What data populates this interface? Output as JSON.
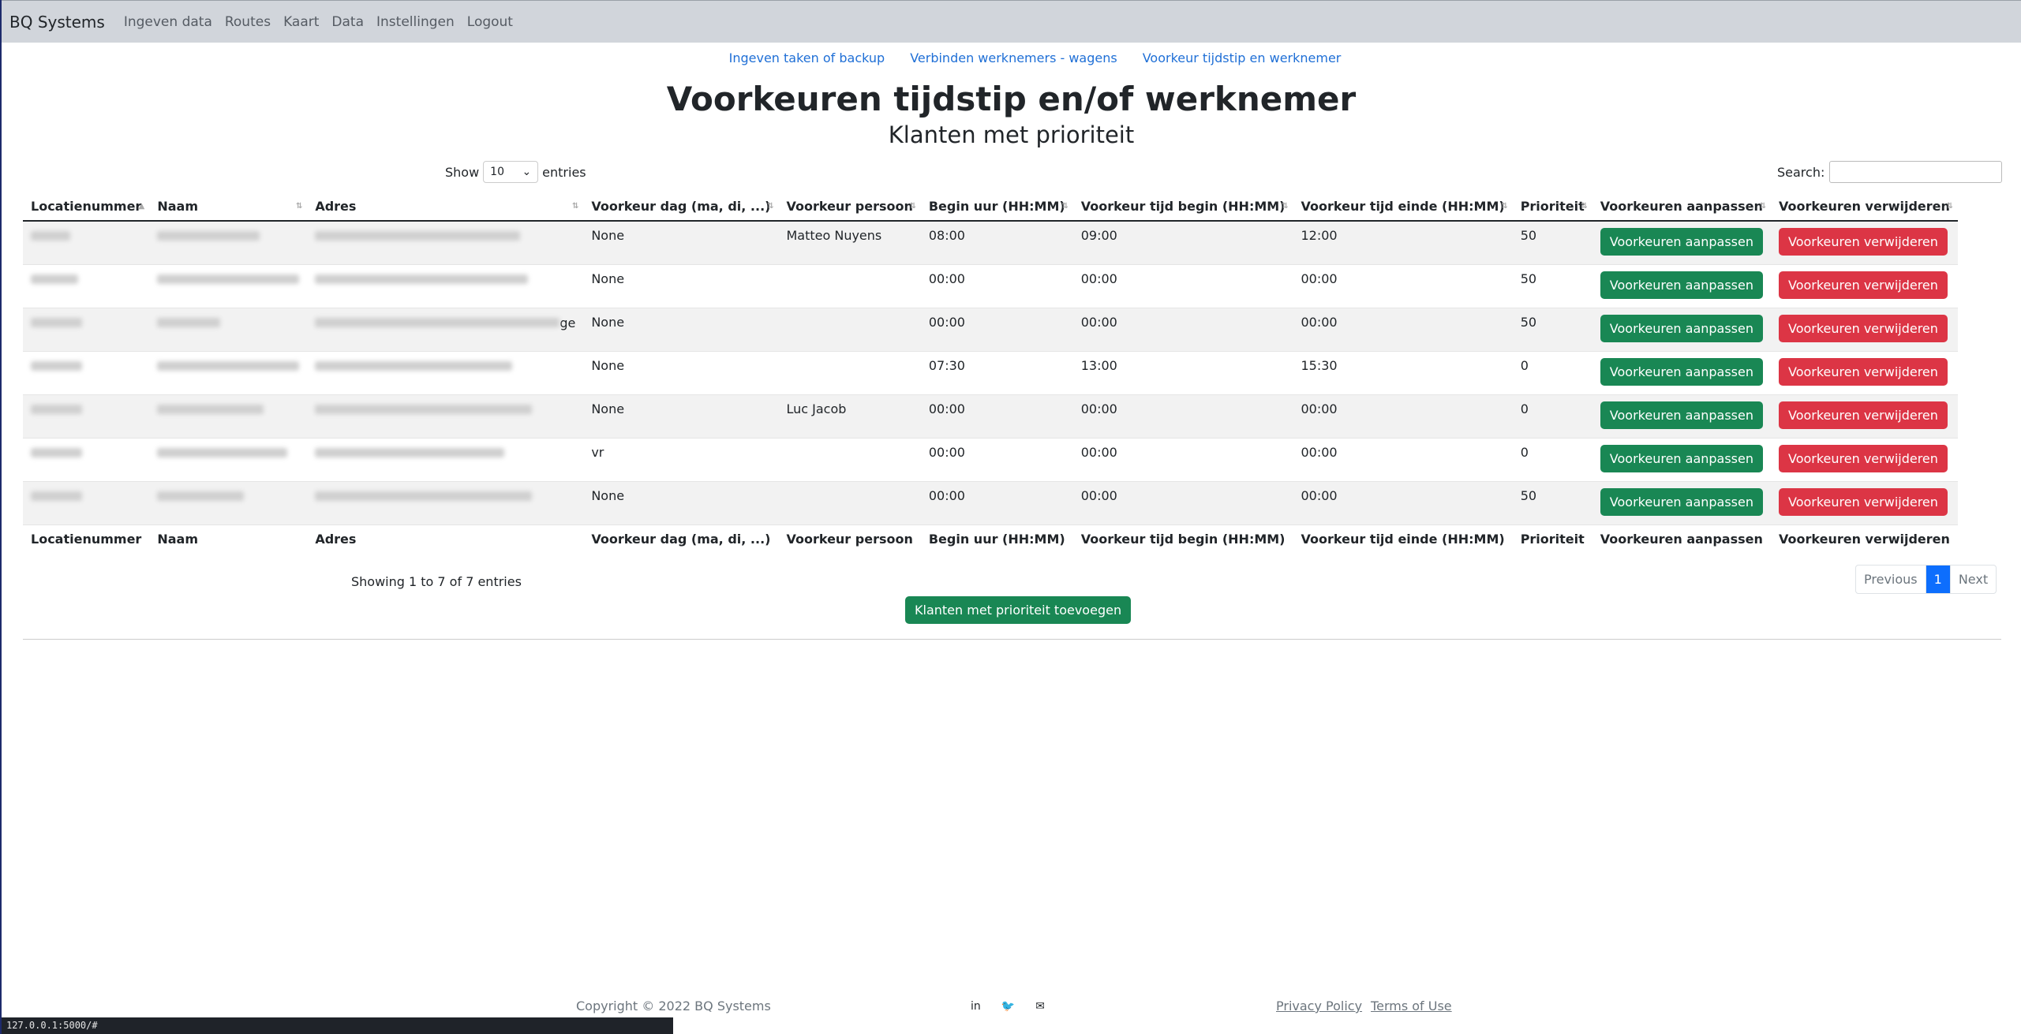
{
  "navbar": {
    "brand": "BQ Systems",
    "items": [
      "Ingeven data",
      "Routes",
      "Kaart",
      "Data",
      "Instellingen",
      "Logout"
    ]
  },
  "subnav": [
    "Ingeven taken of backup",
    "Verbinden werknemers - wagens",
    "Voorkeur tijdstip en werknemer"
  ],
  "page": {
    "title": "Voorkeuren tijdstip en/of werknemer",
    "subtitle": "Klanten met prioriteit"
  },
  "controls": {
    "show_label": "Show",
    "entries_label": "entries",
    "page_size": "10",
    "search_label": "Search:"
  },
  "table": {
    "columns": [
      "Locatienummer",
      "Naam",
      "Adres",
      "Voorkeur dag (ma, di, ...)",
      "Voorkeur persoon",
      "Begin uur (HH:MM)",
      "Voorkeur tijd begin (HH:MM)",
      "Voorkeur tijd einde (HH:MM)",
      "Prioriteit",
      "Voorkeuren aanpassen",
      "Voorkeuren verwijderen"
    ],
    "rows": [
      {
        "dag": "None",
        "persoon": "Matteo Nuyens",
        "begin": "08:00",
        "tijd_begin": "09:00",
        "tijd_einde": "12:00",
        "prioriteit": "50"
      },
      {
        "dag": "None",
        "persoon": "",
        "begin": "00:00",
        "tijd_begin": "00:00",
        "tijd_einde": "00:00",
        "prioriteit": "50"
      },
      {
        "dag": "None",
        "persoon": "",
        "begin": "00:00",
        "tijd_begin": "00:00",
        "tijd_einde": "00:00",
        "prioriteit": "50",
        "adres_suffix": "ge"
      },
      {
        "dag": "None",
        "persoon": "",
        "begin": "07:30",
        "tijd_begin": "13:00",
        "tijd_einde": "15:30",
        "prioriteit": "0"
      },
      {
        "dag": "None",
        "persoon": "Luc Jacob",
        "begin": "00:00",
        "tijd_begin": "00:00",
        "tijd_einde": "00:00",
        "prioriteit": "0"
      },
      {
        "dag": "vr",
        "persoon": "",
        "begin": "00:00",
        "tijd_begin": "00:00",
        "tijd_einde": "00:00",
        "prioriteit": "0"
      },
      {
        "dag": "None",
        "persoon": "",
        "begin": "00:00",
        "tijd_begin": "00:00",
        "tijd_einde": "00:00",
        "prioriteit": "50"
      }
    ],
    "edit_label": "Voorkeuren aanpassen",
    "delete_label": "Voorkeuren verwijderen"
  },
  "info": "Showing 1 to 7 of 7 entries",
  "pager": {
    "previous": "Previous",
    "current": "1",
    "next": "Next"
  },
  "add_button": "Klanten met prioriteit toevoegen",
  "footer": {
    "copyright": "Copyright © 2022 BQ Systems",
    "privacy": "Privacy Policy",
    "terms": "Terms of Use"
  },
  "statusbar": "127.0.0.1:5000/#",
  "colors": {
    "green": "#198754",
    "red": "#dc3545",
    "blue": "#0d6efd",
    "link": "#1f6fd6"
  }
}
